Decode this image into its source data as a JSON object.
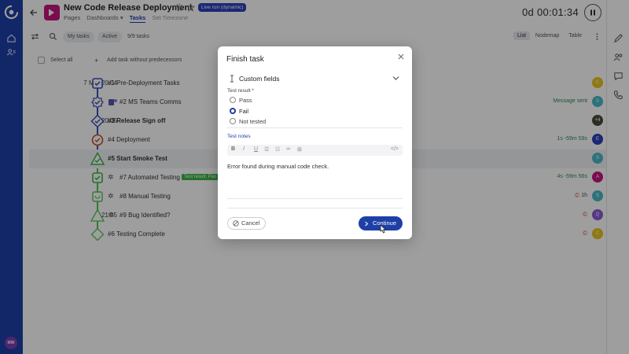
{
  "header": {
    "title": "New Code Release Deployment",
    "live_badge": "Live run (dynamic)",
    "tabs": [
      "Pages",
      "Dashboards",
      "Tasks",
      "Set Timezone"
    ],
    "timer": "0d 00:01:34"
  },
  "user": {
    "initials": "MW"
  },
  "toolbar": {
    "my_tasks": "My tasks",
    "active": "Active",
    "count": "9/9 tasks",
    "views": [
      "List",
      "Nodemap",
      "Table"
    ]
  },
  "list": {
    "select_all": "Select all",
    "add_task": "Add task without predecessors",
    "rows": [
      {
        "time": "7 Mar 20:04",
        "label": "#1 Pre-Deployment Tasks",
        "meta": "",
        "avatar": "C",
        "avatar_color": "#e9c21e"
      },
      {
        "time": "",
        "label": "#2 MS Teams Comms",
        "meta": "Message sent",
        "avatar": "S",
        "avatar_color": "#48b8c8"
      },
      {
        "time": "20:05",
        "label": "#3 Release Sign off",
        "meta": "",
        "avatar": "+4",
        "avatar_color": "#4a4a3a"
      },
      {
        "time": "",
        "label": "#4 Deployment",
        "meta": "1s -59m 59s",
        "avatar": "E",
        "avatar_color": "#2a3fbf"
      },
      {
        "time": "",
        "label": "#5 Start Smoke Test",
        "meta": "",
        "avatar": "S",
        "avatar_color": "#48b8c8"
      },
      {
        "time": "",
        "label": "#7 Automated Testing",
        "tag": "Test result: Pas",
        "meta": "4s -59m 56s",
        "avatar": "A",
        "avatar_color": "#c3167d"
      },
      {
        "time": "",
        "label": "#8 Manual Testing",
        "meta": "1h",
        "avatar": "S",
        "avatar_color": "#48b8c8"
      },
      {
        "time": "21:05",
        "label": "#9 Bug Identified?",
        "meta": "",
        "avatar": "Q",
        "avatar_color": "#8a5bd6"
      },
      {
        "time": "",
        "label": "#6 Testing Complete",
        "meta": "",
        "avatar": "C",
        "avatar_color": "#e9c21e"
      }
    ]
  },
  "modal": {
    "title": "Finish task",
    "section": "Custom fields",
    "field_label": "Test result *",
    "options": [
      "Pass",
      "Fail",
      "Not tested"
    ],
    "selected": "Fail",
    "notes_label": "Test notes",
    "notes_text": "Error found during manual code check.",
    "cancel": "Cancel",
    "continue": "Continue"
  }
}
